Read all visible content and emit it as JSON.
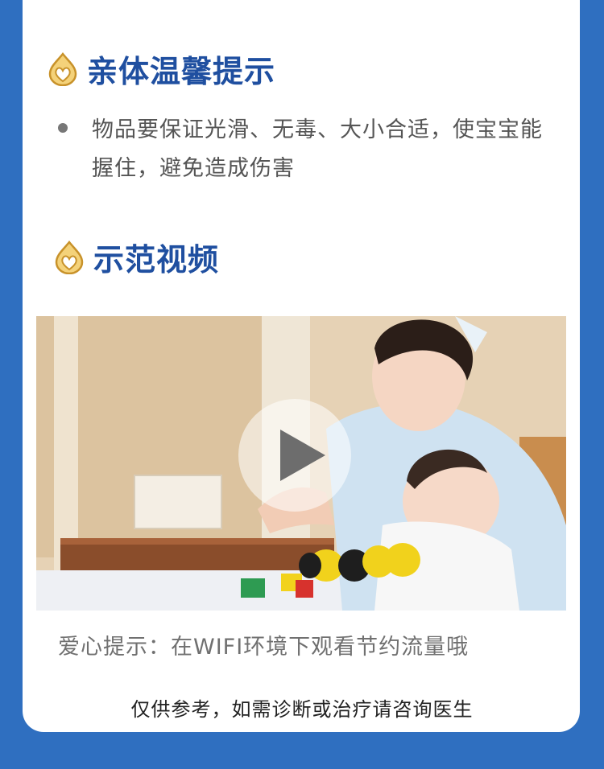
{
  "sections": {
    "tips": {
      "title": "亲体温馨提示",
      "icon": "heart-drop-icon"
    },
    "demo": {
      "title": "示范视频",
      "icon": "heart-drop-icon"
    }
  },
  "tips": {
    "items": [
      {
        "text": "物品要保证光滑、无毒、大小合适，使宝宝能握住，避免造成伤害"
      }
    ]
  },
  "video": {
    "play_icon": "play-icon"
  },
  "footer": {
    "love_tip": "爱心提示：在WIFI环境下观看节约流量哦",
    "disclaimer": "仅供参考，如需诊断或治疗请咨询医生"
  },
  "colors": {
    "background": "#2f6fc0",
    "title": "#1f4fa0",
    "icon_gold": "#d9a531",
    "text": "#555555"
  }
}
